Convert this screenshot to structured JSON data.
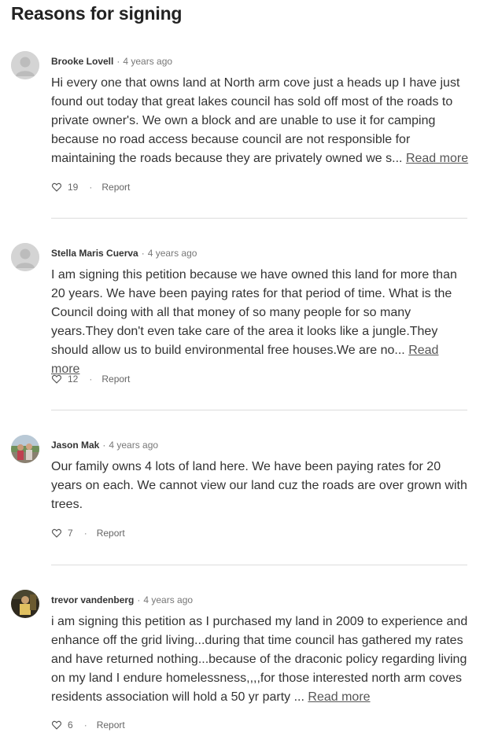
{
  "heading": "Reasons for signing",
  "separator": "·",
  "report_label": "Report",
  "read_more_label": "Read more",
  "comments": [
    {
      "author": "Brooke Lovell",
      "time": "4 years ago",
      "avatar": "default-avatar",
      "body": "Hi every one that owns land at North arm cove just a heads up I have just found out today that great lakes council has sold off most of the roads to private owner's. We own a block and are unable to use it for camping because no road access because council are not responsible for maintaining the roads because they are privately owned we s...",
      "likes": "19"
    },
    {
      "author": "Stella Maris Cuerva",
      "time": "4 years ago",
      "avatar": "default-avatar",
      "body": "I am signing this petition because we have owned this land for more than 20 years. We have been paying rates for that period of time. What is the Council doing with all that money of so many people for so many years.They don't even take care of the area it looks like a jungle.They should allow us to build environmental free houses.We are no...",
      "likes": "12"
    },
    {
      "author": "Jason Mak",
      "time": "4 years ago",
      "avatar": "photo-avatar",
      "body": "Our family owns 4 lots of land here. We have been paying rates for 20 years on each. We cannot view our land cuz the roads are over grown with trees.",
      "likes": "7"
    },
    {
      "author": "trevor vandenberg",
      "time": "4 years ago",
      "avatar": "photo-avatar",
      "body": "i am signing this petition as I purchased my land in 2009 to experience and enhance off the grid living...during that time council has gathered my rates and have returned nothing...because of the draconic policy regarding living on my land I endure homelessness,,,,for those interested north arm coves residents association will hold a 50 yr party ...",
      "likes": "6"
    }
  ]
}
